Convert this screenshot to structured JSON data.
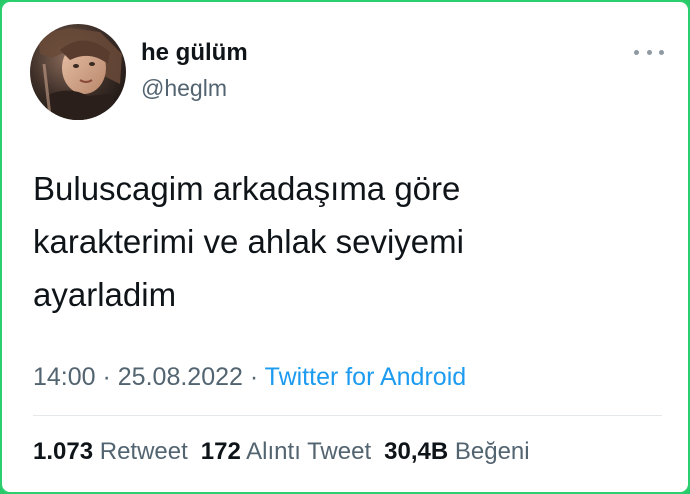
{
  "colors": {
    "frame_border": "#2ccf6d",
    "text_primary": "#0f1419",
    "text_secondary": "#536471",
    "link": "#1d9bf0"
  },
  "author": {
    "display_name": "he gülüm",
    "handle": "@heglm",
    "avatar_icon": "user-avatar-photo"
  },
  "more_menu_icon": "more-horizontal-icon",
  "tweet": {
    "lines": [
      "Buluscagim arkadaşıma göre",
      "karakterimi ve ahlak seviyemi",
      "ayarladim"
    ]
  },
  "meta": {
    "time": "14:00",
    "separator1": " · ",
    "date": "25.08.2022",
    "separator2": " · ",
    "source": "Twitter for Android"
  },
  "stats": {
    "retweets_count": "1.073",
    "retweets_label": "Retweet",
    "quotes_count": "172",
    "quotes_label": "Alıntı Tweet",
    "likes_count": "30,4B",
    "likes_label": "Beğeni"
  }
}
